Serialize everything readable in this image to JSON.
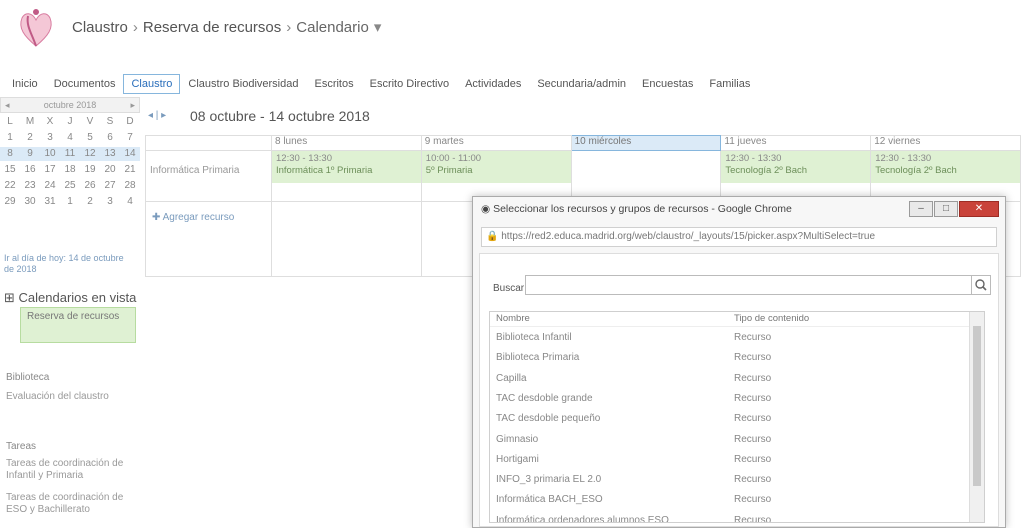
{
  "breadcrumb": {
    "site": "Claustro",
    "page": "Reserva de recursos",
    "current": "Calendario"
  },
  "nav": [
    "Inicio",
    "Documentos",
    "Claustro",
    "Claustro Biodiversidad",
    "Escritos",
    "Escrito Directivo",
    "Actividades",
    "Secundaria/admin",
    "Encuestas",
    "Familias"
  ],
  "nav_active_index": 2,
  "minical": {
    "header": "octubre 2018",
    "days": [
      "L",
      "M",
      "X",
      "J",
      "V",
      "S",
      "D"
    ],
    "weeks": [
      [
        "1",
        "2",
        "3",
        "4",
        "5",
        "6",
        "7"
      ],
      [
        "8",
        "9",
        "10",
        "11",
        "12",
        "13",
        "14"
      ],
      [
        "15",
        "16",
        "17",
        "18",
        "19",
        "20",
        "21"
      ],
      [
        "22",
        "23",
        "24",
        "25",
        "26",
        "27",
        "28"
      ],
      [
        "29",
        "30",
        "31",
        "1",
        "2",
        "3",
        "4"
      ]
    ],
    "selected_row": 1
  },
  "goto": "Ir al día de hoy: 14 de octubre de 2018",
  "sidebar": {
    "calendars_title": "Calendarios en vista",
    "resource_button": "Reserva de recursos",
    "section1": "Biblioteca",
    "section1_sub": "Evaluación del claustro",
    "section2": "Tareas",
    "items": [
      "Tareas de coordinación de Infantil y Primaria",
      "Tareas de coordinación de ESO y Bachillerato"
    ]
  },
  "toolbar": {
    "arrows": "◂ | ▸",
    "range": "08 octubre - 14 octubre 2018"
  },
  "grid": {
    "columns": [
      "8 lunes",
      "9 martes",
      "10 miércoles",
      "11 jueves",
      "12 viernes"
    ],
    "today_index": 2,
    "row_label": "Informática Primaria",
    "events": [
      {
        "col": 0,
        "time": "12:30 - 13:30",
        "sub": "Informática 1º Primaria"
      },
      {
        "col": 1,
        "time": "10:00 - 11:00",
        "sub": "5º Primaria"
      },
      {
        "col": 3,
        "time": "12:30 - 13:30",
        "sub": "Tecnología 2º Bach"
      },
      {
        "col": 4,
        "time": "12:30 - 13:30",
        "sub": "Tecnología 2º Bach"
      }
    ],
    "add_label": "Agregar recurso"
  },
  "dialog": {
    "title": "Seleccionar los recursos y grupos de recursos - Google Chrome",
    "url": "https://red2.educa.madrid.org/web/claustro/_layouts/15/picker.aspx?MultiSelect=true",
    "search_label": "Buscar",
    "col_name": "Nombre",
    "col_type": "Tipo de contenido",
    "rows": [
      [
        "Biblioteca Infantil",
        "Recurso"
      ],
      [
        "Biblioteca Primaria",
        "Recurso"
      ],
      [
        "Capilla",
        "Recurso"
      ],
      [
        "TAC desdoble grande",
        "Recurso"
      ],
      [
        "TAC desdoble pequeño",
        "Recurso"
      ],
      [
        "Gimnasio",
        "Recurso"
      ],
      [
        "Hortigami",
        "Recurso"
      ],
      [
        "INFO_3 primaria EL 2.0",
        "Recurso"
      ],
      [
        "Informática BACH_ESO",
        "Recurso"
      ],
      [
        "Informática ordenadores alumnos ESO",
        "Recurso"
      ]
    ]
  }
}
